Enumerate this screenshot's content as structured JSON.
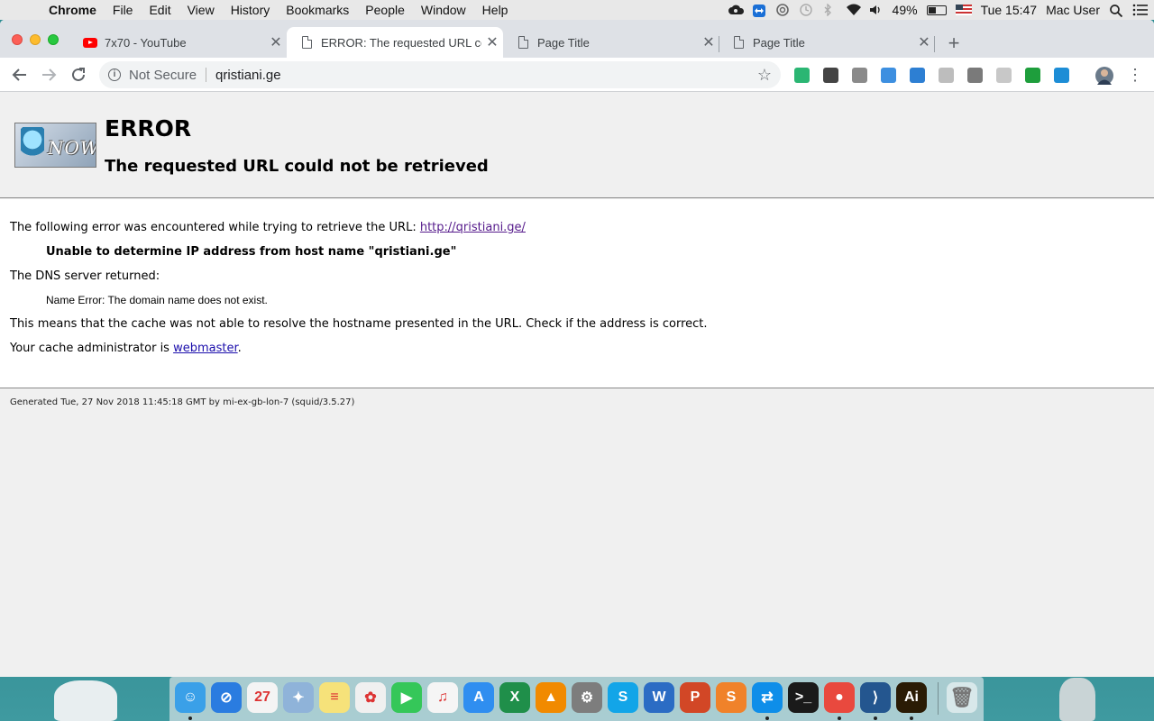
{
  "menubar": {
    "app_name": "Chrome",
    "menus": [
      "File",
      "Edit",
      "View",
      "History",
      "Bookmarks",
      "People",
      "Window",
      "Help"
    ],
    "battery": "49%",
    "battery_level": 0.49,
    "clock": "Tue 15:47",
    "user": "Mac User",
    "status_icons": [
      "creative-cloud-icon",
      "teamviewer-icon",
      "cc-sync-icon",
      "time-machine-icon",
      "bluetooth-icon",
      "wifi-icon",
      "volume-icon",
      "battery-icon",
      "us-flag-icon",
      "spotlight-icon",
      "notification-center-icon"
    ]
  },
  "tabs": [
    {
      "title": "7x70 - YouTube",
      "icon": "youtube-icon",
      "active": false
    },
    {
      "title": "ERROR: The requested URL co",
      "icon": "document-icon",
      "active": true
    },
    {
      "title": "Page Title",
      "icon": "document-icon",
      "active": false
    },
    {
      "title": "Page Title",
      "icon": "document-icon",
      "active": false
    }
  ],
  "toolbar": {
    "security_label": "Not Secure",
    "url": "qristiani.ge",
    "extensions": [
      {
        "name": "green-extension-icon",
        "color": "#2bb673"
      },
      {
        "name": "film-reel-extension-icon",
        "color": "#444444"
      },
      {
        "name": "shield-extension-icon",
        "color": "#8a8a8a"
      },
      {
        "name": "blue-square-extension-icon",
        "color": "#3d8fe0"
      },
      {
        "name": "download-arrow-extension-icon",
        "color": "#2d7fd3"
      },
      {
        "name": "calendar-extension-icon",
        "color": "#bdbdbd"
      },
      {
        "name": "vee-extension-icon",
        "color": "#7a7a7a"
      },
      {
        "name": "mail-extension-icon",
        "color": "#c8c8c8"
      },
      {
        "name": "green-download-extension-icon",
        "color": "#1e9e3c"
      },
      {
        "name": "s-extension-icon",
        "color": "#1d8dd6"
      }
    ]
  },
  "page": {
    "logo_text": "NOW",
    "title": "ERROR",
    "subtitle": "The requested URL could not be retrieved",
    "intro_text": "The following error was encountered while trying to retrieve the URL: ",
    "intro_link": "http://qristiani.ge/",
    "error_detail": "Unable to determine IP address from host name \"qristiani.ge\"",
    "dns_label": "The DNS server returned:",
    "dns_message": "Name Error: The domain name does not exist.",
    "explanation": "This means that the cache was not able to resolve the hostname presented in the URL. Check if the address is correct.",
    "admin_prefix": "Your cache administrator is ",
    "admin_link": "webmaster",
    "admin_suffix": ".",
    "footer": "Generated Tue, 27 Nov 2018 11:45:18 GMT by mi-ex-gb-lon-7 (squid/3.5.27)"
  },
  "dock": {
    "apps": [
      {
        "name": "finder-icon",
        "color": "#3aa0e8",
        "glyph": "☺",
        "running": true
      },
      {
        "name": "safari-icon",
        "color": "#2a7ce0",
        "glyph": "⊘",
        "running": false
      },
      {
        "name": "calendar-icon",
        "color": "#f4f4f4",
        "glyph": "27",
        "running": false
      },
      {
        "name": "preview-icon",
        "color": "#8fb3d9",
        "glyph": "✦",
        "running": false
      },
      {
        "name": "notes-icon",
        "color": "#f6e27a",
        "glyph": "≡",
        "running": false
      },
      {
        "name": "photos-icon",
        "color": "#f0f0f0",
        "glyph": "✿",
        "running": false
      },
      {
        "name": "facetime-icon",
        "color": "#35c759",
        "glyph": "▶",
        "running": false
      },
      {
        "name": "itunes-icon",
        "color": "#f5f5f5",
        "glyph": "♫",
        "running": false
      },
      {
        "name": "app-store-icon",
        "color": "#2f8ef0",
        "glyph": "A",
        "running": false
      },
      {
        "name": "excel-icon",
        "color": "#1f8f4a",
        "glyph": "X",
        "running": false
      },
      {
        "name": "vlc-icon",
        "color": "#f18a00",
        "glyph": "▲",
        "running": false
      },
      {
        "name": "system-preferences-icon",
        "color": "#7d7d7d",
        "glyph": "⚙",
        "running": false
      },
      {
        "name": "skype-icon",
        "color": "#12a5e8",
        "glyph": "S",
        "running": false
      },
      {
        "name": "word-icon",
        "color": "#2b6cc4",
        "glyph": "W",
        "running": false
      },
      {
        "name": "powerpoint-icon",
        "color": "#d24726",
        "glyph": "P",
        "running": false
      },
      {
        "name": "sublime-text-icon",
        "color": "#f0822a",
        "glyph": "S",
        "running": false
      },
      {
        "name": "teamviewer-icon",
        "color": "#0e8ee9",
        "glyph": "⇄",
        "running": true
      },
      {
        "name": "terminal-icon",
        "color": "#1a1a1a",
        "glyph": ">_",
        "running": false
      },
      {
        "name": "chrome-icon",
        "color": "#e9493e",
        "glyph": "●",
        "running": true
      },
      {
        "name": "vscode-icon",
        "color": "#24568f",
        "glyph": "⟩",
        "running": true
      },
      {
        "name": "illustrator-icon",
        "color": "#2a1b05",
        "glyph": "Ai",
        "running": true
      }
    ],
    "trash": {
      "name": "trash-icon",
      "glyph": "🗑"
    }
  }
}
